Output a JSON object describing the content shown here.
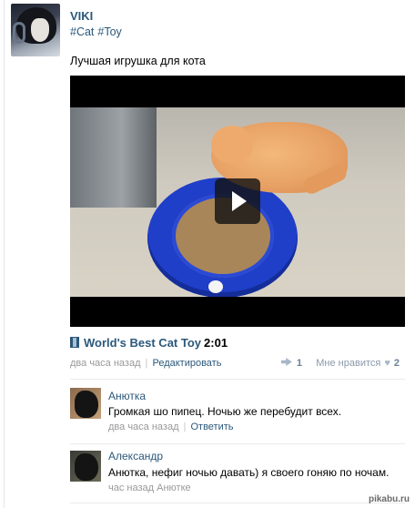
{
  "post": {
    "author": "VIKI",
    "tags": [
      "#Cat",
      "#Toy"
    ],
    "text": "Лучшая игрушка для кота"
  },
  "video": {
    "title": "World's Best Cat Toy",
    "duration": "2:01"
  },
  "meta": {
    "time": "два часа назад",
    "edit_label": "Редактировать",
    "shares": "1",
    "like_label": "Мне нравится",
    "likes": "2"
  },
  "comments": [
    {
      "name": "Анютка",
      "text": "Громкая шо пипец. Ночью же перебудит всех.",
      "time": "два часа назад",
      "reply_label": "Ответить"
    },
    {
      "name": "Александр",
      "text": "Анютка, нефиг ночью давать) я своего гоняю по ночам.",
      "time": "час назад",
      "reply_to": "Анютке"
    }
  ],
  "watermark": "pikabu.ru",
  "icons": {
    "share": "megaphone-icon",
    "like": "heart-icon",
    "video": "film-icon",
    "play": "play-icon"
  },
  "colors": {
    "link": "#2b587a",
    "muted": "#999999",
    "video_bg": "#000000"
  }
}
